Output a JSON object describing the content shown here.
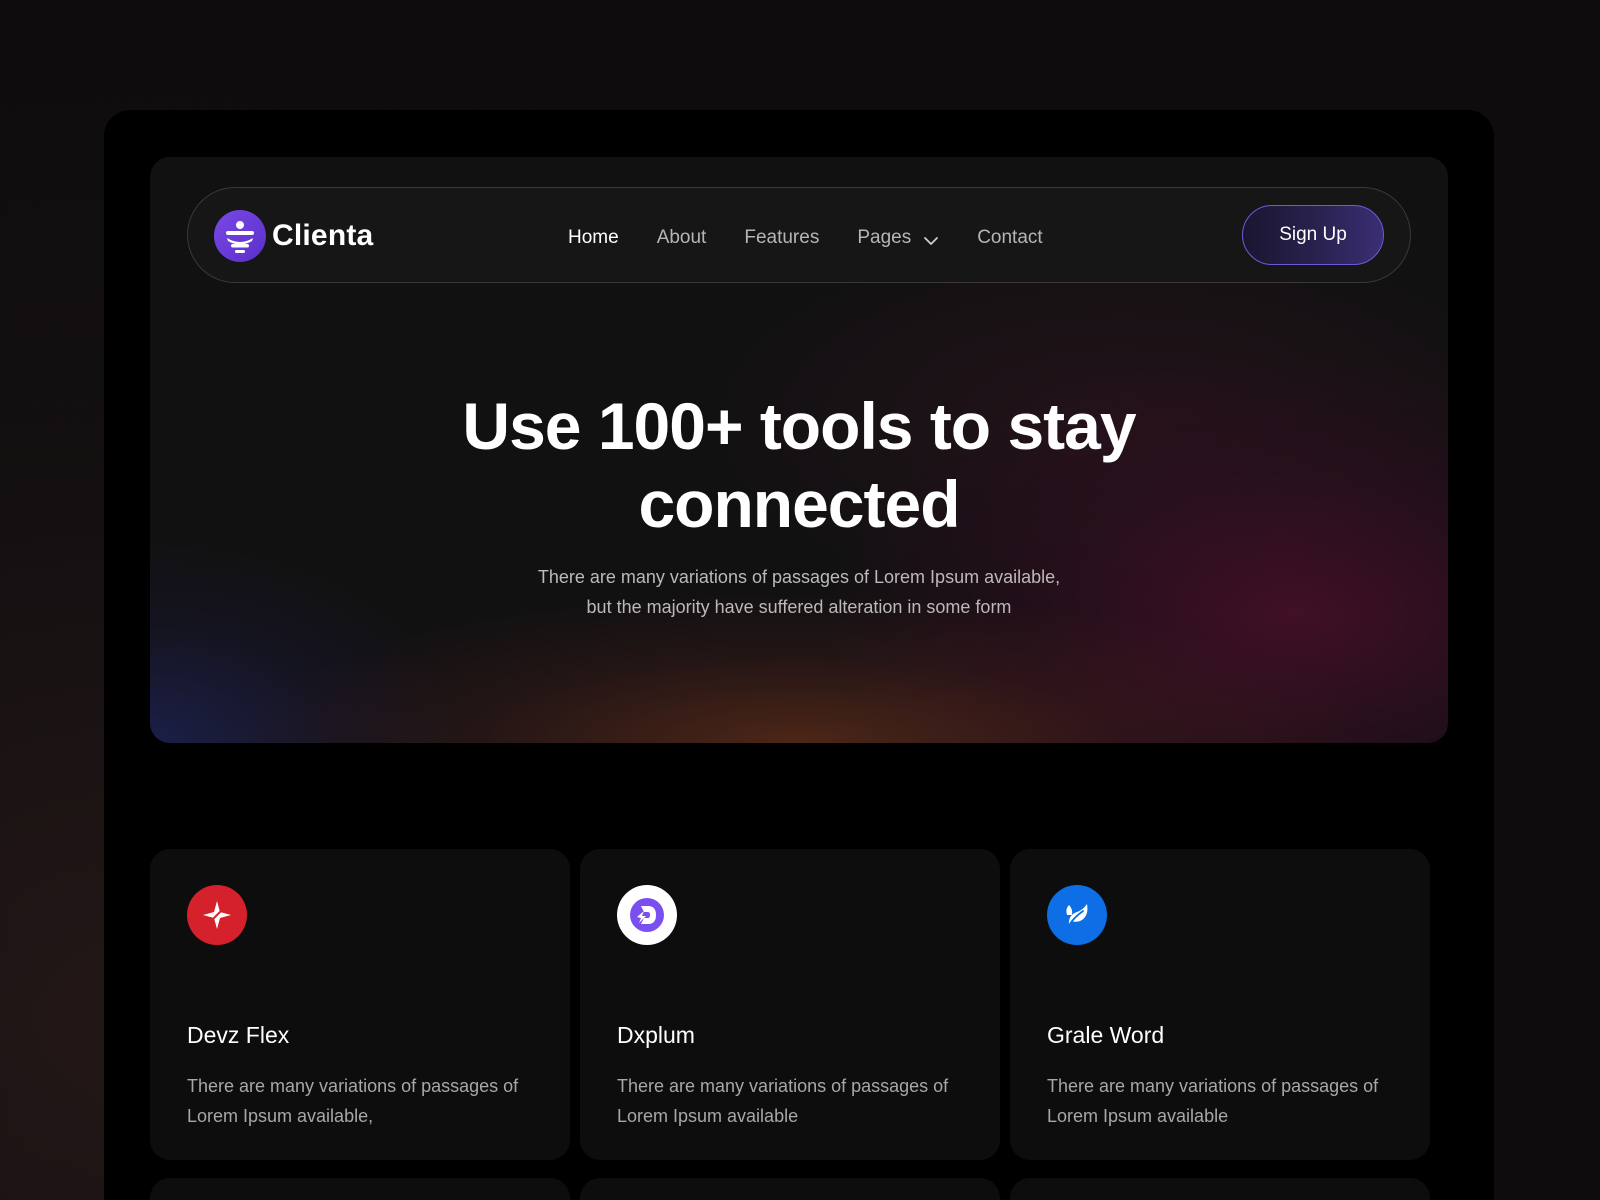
{
  "brand": {
    "name": "Clienta",
    "logo_icon": "clienta-logo-icon",
    "accent": "#6a3bdc"
  },
  "nav": {
    "links": [
      {
        "label": "Home",
        "active": true
      },
      {
        "label": "About",
        "active": false
      },
      {
        "label": "Features",
        "active": false
      },
      {
        "label": "Pages",
        "active": false,
        "dropdown": true
      },
      {
        "label": "Contact",
        "active": false
      }
    ],
    "signup_label": "Sign Up"
  },
  "hero": {
    "title_line1": "Use 100+ tools to stay",
    "title_line2": "connected",
    "subtitle_line1": "There are many variations of passages of Lorem Ipsum available,",
    "subtitle_line2": "but the majority have suffered alteration in some form"
  },
  "cards": [
    {
      "title": "Devz Flex",
      "desc_line1": "There are many variations of passages of",
      "desc_line2": "Lorem Ipsum available,",
      "icon": "devz-flex-icon",
      "icon_color": "#d4212b"
    },
    {
      "title": "Dxplum",
      "desc_line1": "There are many variations of passages of",
      "desc_line2": "Lorem Ipsum available",
      "icon": "dxplum-icon",
      "icon_color": "#ffffff"
    },
    {
      "title": "Grale Word",
      "desc_line1": "There are many variations of passages of",
      "desc_line2": "Lorem Ipsum available",
      "icon": "grale-word-icon",
      "icon_color": "#0d6ee6"
    }
  ]
}
